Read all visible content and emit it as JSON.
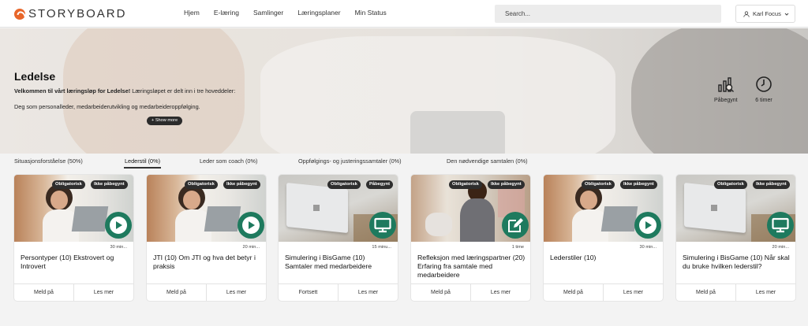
{
  "brand": {
    "logo_text": "STORYBOARD",
    "accent": "#e8662a"
  },
  "nav": {
    "items": [
      "Hjem",
      "E-læring",
      "Samlinger",
      "Læringsplaner",
      "Min Status"
    ]
  },
  "search": {
    "placeholder": "Search..."
  },
  "user": {
    "name": "Karl Focus"
  },
  "hero": {
    "title": "Ledelse",
    "intro_bold": "Velkommen til vårt læringsløp for Ledelse!",
    "intro_rest": " Læringsløpet er delt inn i tre hoveddeler:",
    "intro_line2": "Deg som personalleder, medarbeiderutvikling og medarbeideroppfølging.",
    "show_more": "+ Show more",
    "status_label": "Påbegynt",
    "duration_label": "6 timer"
  },
  "tabs": [
    {
      "label": "Situasjonsforståelse (50%)",
      "active": false
    },
    {
      "label": "Lederstil (0%)",
      "active": true
    },
    {
      "label": "Leder som coach (0%)",
      "active": false
    },
    {
      "label": "Oppfølgings- og justeringssamtaler (0%)",
      "active": false
    },
    {
      "label": "Den nødvendige samtalen (0%)",
      "active": false
    }
  ],
  "cards": [
    {
      "badge1": "Obligatorisk",
      "badge2": "Ikke påbegynt",
      "duration": "30 min...",
      "title": "Persontyper (10) Ekstrovert og Introvert",
      "action": "Meld på",
      "more": "Les mer",
      "icon": "play-icon",
      "image": "woman-laptop"
    },
    {
      "badge1": "Obligatorisk",
      "badge2": "Ikke påbegynt",
      "duration": "20 min...",
      "title": "JTI (10) Om JTI og hva det betyr i praksis",
      "action": "Meld på",
      "more": "Les mer",
      "icon": "play-icon",
      "image": "woman-laptop"
    },
    {
      "badge1": "Obligatorisk",
      "badge2": "Påbegynt",
      "duration": "15 minu...",
      "title": "Simulering i BisGame (10) Samtaler med medarbeidere",
      "action": "Fortsett",
      "more": "Les mer",
      "icon": "monitor-icon",
      "image": "laptop"
    },
    {
      "badge1": "Obligatorisk",
      "badge2": "Ikke påbegynt",
      "duration": "1 time",
      "title": "Refleksjon med læringspartner (20) Erfaring fra samtale med medarbeidere",
      "action": "Meld på",
      "more": "Les mer",
      "icon": "edit-icon",
      "image": "office-people"
    },
    {
      "badge1": "Obligatorisk",
      "badge2": "Ikke påbegynt",
      "duration": "30 min...",
      "title": "Lederstiler (10)",
      "action": "Meld på",
      "more": "Les mer",
      "icon": "play-icon",
      "image": "woman-laptop"
    },
    {
      "badge1": "Obligatorisk",
      "badge2": "Ikke påbegynt",
      "duration": "20 min...",
      "title": "Simulering i BisGame (10) Når skal du bruke hvilken lederstil?",
      "action": "Meld på",
      "more": "Les mer",
      "icon": "monitor-icon",
      "image": "laptop"
    }
  ],
  "colors": {
    "play_button": "#1e7a5e",
    "badge": "#2e2e2e"
  }
}
